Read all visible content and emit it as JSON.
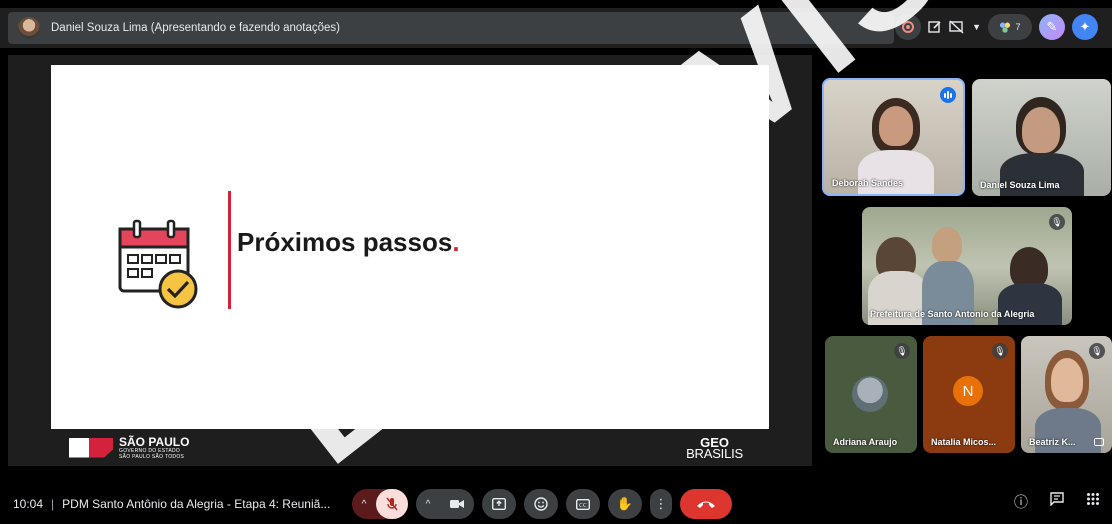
{
  "presenter_bar": {
    "name": "Daniel Souza Lima (Apresentando e fazendo anotações)",
    "participant_count": "7"
  },
  "slide": {
    "title": "Próximos passos",
    "title_dot": ".",
    "logo_sp_main": "SÃO PAULO",
    "logo_sp_sub1": "GOVERNO DO ESTADO",
    "logo_sp_sub2": "SÃO PAULO SÃO TODOS",
    "logo_geo_top": "GEO",
    "logo_geo_bottom": "BRASILIS"
  },
  "participants": {
    "deborah": "Deborah Sandes",
    "daniel": "Daniel Souza Lima",
    "prefeitura": "Prefeitura de Santo Antonio da Alegria",
    "adriana": "Adriana Araujo",
    "natalia": "Natalia Micos...",
    "natalia_initial": "N",
    "beatriz": "Beatriz K..."
  },
  "bottom_bar": {
    "time": "10:04",
    "separator": "|",
    "meeting_title": "PDM Santo Antônio da Alegria - Etapa 4: Reuniã..."
  },
  "watermark_text": "EM REVISÃO",
  "colors": {
    "accent_red": "#d4223c",
    "end_call": "#dc362e",
    "active_speaker": "#8ab4f8",
    "natalia_bg": "#8c3b11"
  },
  "icons": [
    "record-icon",
    "annotate-icon",
    "present-off-icon",
    "people-icon",
    "gemini-icon",
    "ai-assistant-icon",
    "mic-off-icon",
    "camera-icon",
    "present-icon",
    "emoji-icon",
    "captions-icon",
    "raise-hand-icon",
    "more-icon",
    "end-call-icon",
    "info-icon",
    "chat-icon",
    "activities-icon"
  ]
}
